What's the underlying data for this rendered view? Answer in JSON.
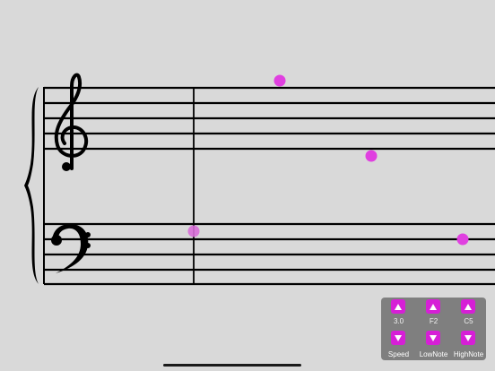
{
  "colors": {
    "background": "#d9d9d9",
    "staff_line": "#000000",
    "note": "#e040e0",
    "panel": "#7f7f7f",
    "button": "#d61fd6"
  },
  "staff": {
    "clefs": [
      "treble-clef",
      "bass-clef"
    ],
    "treble_clef_glyph": "𝄞",
    "bass_clef_glyph": "𝄢"
  },
  "controls": [
    {
      "id": "speed",
      "value": "3.0",
      "label": "Speed",
      "up_icon": "arrow-up-icon",
      "down_icon": "arrow-down-icon"
    },
    {
      "id": "lownote",
      "value": "F2",
      "label": "LowNote",
      "up_icon": "arrow-up-icon",
      "down_icon": "arrow-down-icon"
    },
    {
      "id": "highnote",
      "value": "C5",
      "label": "HighNote",
      "up_icon": "arrow-up-icon",
      "down_icon": "arrow-down-icon"
    }
  ]
}
